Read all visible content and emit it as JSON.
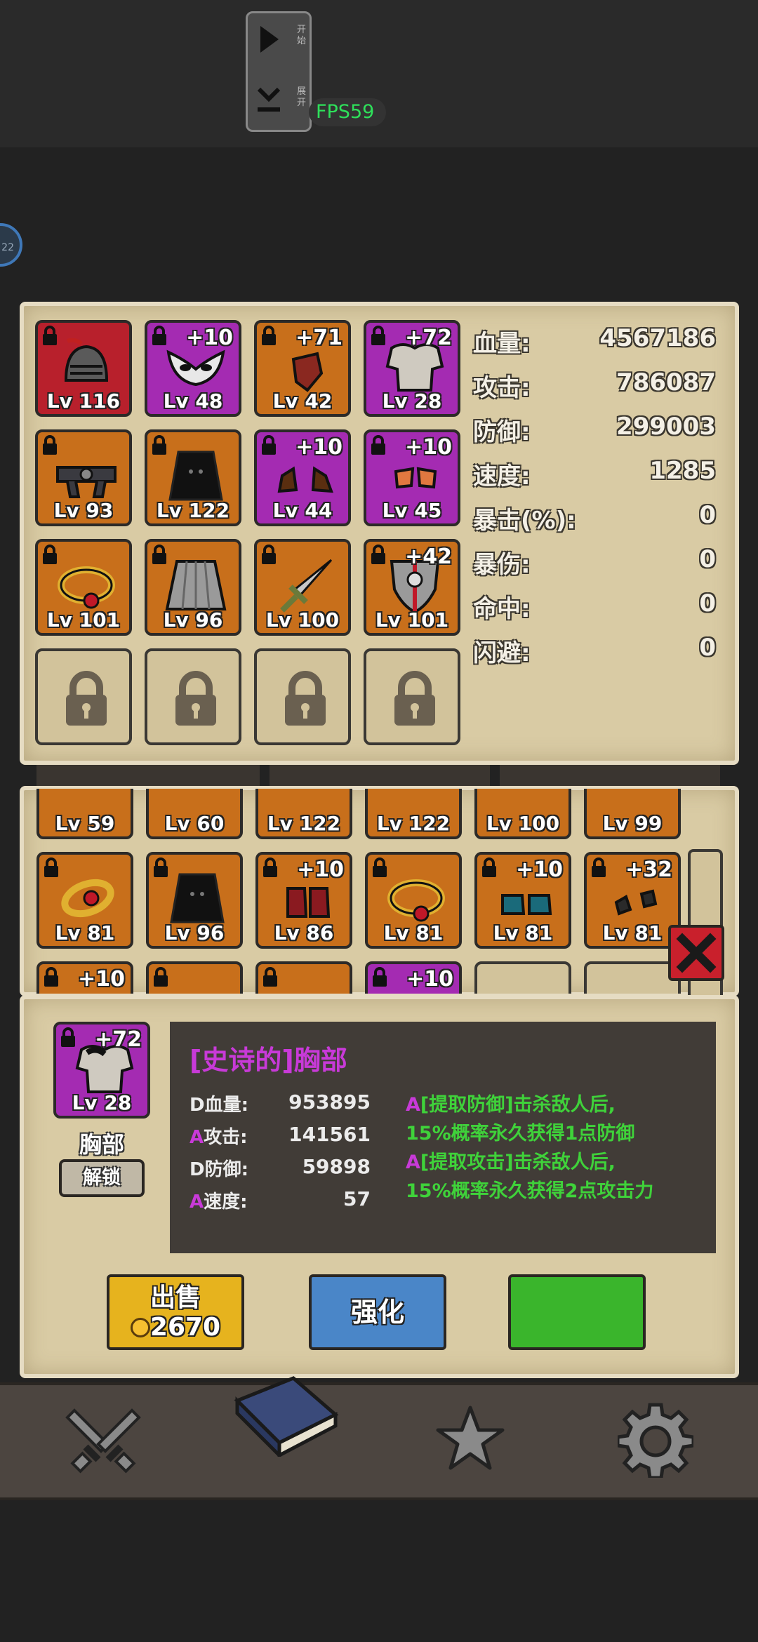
{
  "dev": {
    "start_label": "开始",
    "expand_label": "展开",
    "fps": "FPS59",
    "avatar_text": "22"
  },
  "equipped": [
    {
      "lvl": "Lv 116",
      "plus": "",
      "color": "red",
      "lock": true,
      "item": "helmet"
    },
    {
      "lvl": "Lv 48",
      "plus": "+10",
      "color": "purple",
      "lock": true,
      "item": "mask"
    },
    {
      "lvl": "Lv 42",
      "plus": "+71",
      "color": "orange",
      "lock": true,
      "item": "gauntlet"
    },
    {
      "lvl": "Lv 28",
      "plus": "+72",
      "color": "purple",
      "lock": true,
      "item": "chest"
    },
    {
      "lvl": "Lv 93",
      "plus": "",
      "color": "orange",
      "lock": true,
      "item": "belt"
    },
    {
      "lvl": "Lv 122",
      "plus": "",
      "color": "orange",
      "lock": true,
      "item": "cloak"
    },
    {
      "lvl": "Lv 44",
      "plus": "+10",
      "color": "purple",
      "lock": true,
      "item": "boots"
    },
    {
      "lvl": "Lv 45",
      "plus": "+10",
      "color": "purple",
      "lock": true,
      "item": "gloves"
    },
    {
      "lvl": "Lv 101",
      "plus": "",
      "color": "orange",
      "lock": true,
      "item": "ring"
    },
    {
      "lvl": "Lv 96",
      "plus": "",
      "color": "orange",
      "lock": true,
      "item": "skirt"
    },
    {
      "lvl": "Lv 100",
      "plus": "",
      "color": "orange",
      "lock": true,
      "item": "sword"
    },
    {
      "lvl": "Lv 101",
      "plus": "+42",
      "color": "orange",
      "lock": true,
      "item": "shield"
    }
  ],
  "stats": [
    {
      "label": "血量:",
      "value": "4567186"
    },
    {
      "label": "攻击:",
      "value": "786087"
    },
    {
      "label": "防御:",
      "value": "299003"
    },
    {
      "label": "速度:",
      "value": "1285"
    },
    {
      "label": "暴击(%):",
      "value": "0"
    },
    {
      "label": "暴伤:",
      "value": "0"
    },
    {
      "label": "命中:",
      "value": "0"
    },
    {
      "label": "闪避:",
      "value": "0"
    }
  ],
  "inventory_row1": [
    {
      "lvl": "Lv 59"
    },
    {
      "lvl": "Lv 60"
    },
    {
      "lvl": "Lv 122"
    },
    {
      "lvl": "Lv 122"
    },
    {
      "lvl": "Lv 100"
    },
    {
      "lvl": "Lv 99"
    }
  ],
  "inventory_row2": [
    {
      "lvl": "Lv 81",
      "plus": "",
      "item": "ring2"
    },
    {
      "lvl": "Lv 96",
      "plus": "",
      "item": "cloak"
    },
    {
      "lvl": "Lv 86",
      "plus": "+10",
      "item": "boots2"
    },
    {
      "lvl": "Lv 81",
      "plus": "",
      "item": "ring"
    },
    {
      "lvl": "Lv 81",
      "plus": "+10",
      "item": "bluegrieves"
    },
    {
      "lvl": "Lv 81",
      "plus": "+32",
      "item": "gloves2"
    }
  ],
  "inventory_row3": [
    {
      "plus": "+10"
    },
    {
      "plus": ""
    },
    {
      "plus": ""
    },
    {
      "plus": "+10"
    }
  ],
  "detail": {
    "lvl": "Lv 28",
    "plus": "+72",
    "slot_name": "胸部",
    "unlock_label": "解锁",
    "title": "[史诗的]胸部",
    "attrs": [
      {
        "prefix": "D",
        "name": "血量:",
        "value": "953895"
      },
      {
        "prefix": "A",
        "name": "攻击:",
        "value": "141561"
      },
      {
        "prefix": "D",
        "name": "防御:",
        "value": "59898"
      },
      {
        "prefix": "A",
        "name": "速度:",
        "value": "57"
      }
    ],
    "affixes": [
      {
        "a": "A",
        "text": "[提取防御]击杀敌人后,"
      },
      {
        "a": "",
        "text": "15%概率永久获得1点防御"
      },
      {
        "a": "A",
        "text": "[提取攻击]击杀敌人后,"
      },
      {
        "a": "",
        "text": "15%概率永久获得2点攻击力"
      }
    ],
    "sell_label": "出售",
    "sell_price": "2670",
    "upgrade_label": "强化",
    "green_label": ""
  },
  "colors": {
    "orange": "#c86f1b",
    "purple": "#a42bb2",
    "red": "#b8202c",
    "epic_title": "#c83ad8",
    "affix_green": "#3fd23a"
  }
}
